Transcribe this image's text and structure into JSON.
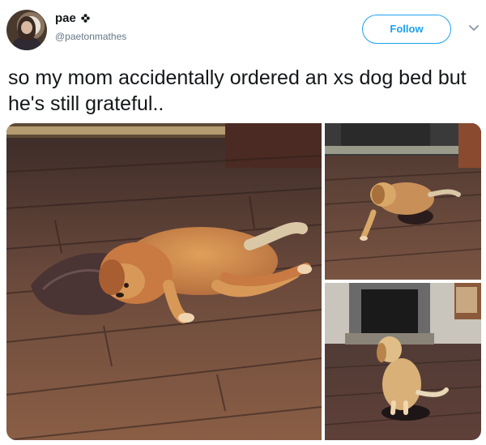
{
  "user": {
    "display_name": "pae",
    "handle": "@paetonmathes"
  },
  "follow_label": "Follow",
  "tweet": {
    "text": "so my mom accidentally ordered an xs dog bed but he's still grateful.."
  },
  "colors": {
    "accent": "#1da1f2",
    "text": "#14171a",
    "secondary_text": "#657786"
  },
  "icons": {
    "verified": "flower-badge-icon",
    "more": "chevron-down-icon"
  }
}
